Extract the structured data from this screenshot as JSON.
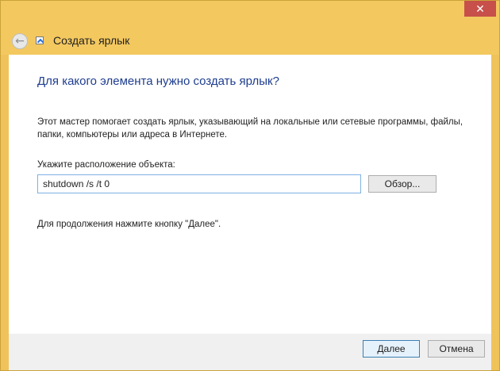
{
  "window": {
    "title": "Создать ярлык",
    "close_glyph": "✕",
    "back_glyph": "←"
  },
  "main": {
    "heading": "Для какого элемента нужно создать ярлык?",
    "description": "Этот мастер помогает создать ярлык, указывающий на локальные или сетевые программы, файлы, папки, компьютеры или адреса в Интернете.",
    "location_label": "Укажите расположение объекта:",
    "location_value": "shutdown /s /t 0",
    "browse_label": "Обзор...",
    "continue_hint": "Для продолжения нажмите кнопку \"Далее\"."
  },
  "footer": {
    "next_label": "Далее",
    "cancel_label": "Отмена"
  },
  "colors": {
    "titlebar": "#f3c85f",
    "close_button": "#c7504a",
    "heading": "#1e3d8f",
    "input_border": "#7fb0e4",
    "primary_button_border": "#3c7fb1"
  },
  "icons": [
    "back-arrow-icon",
    "shortcut-icon",
    "close-icon"
  ]
}
